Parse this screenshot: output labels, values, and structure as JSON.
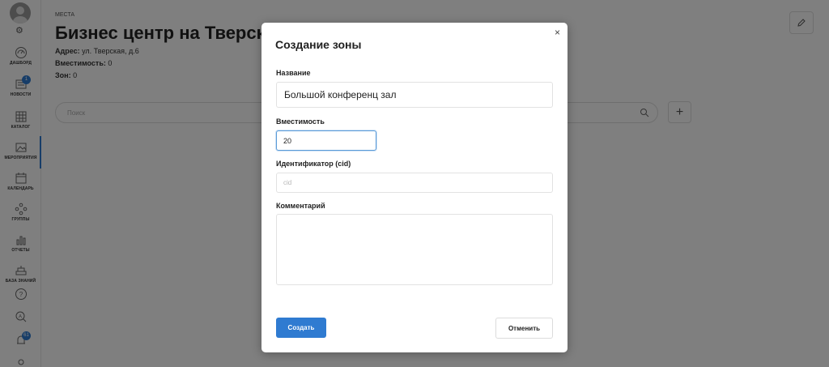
{
  "sidebar": {
    "items": [
      {
        "label": "ДАШБОРД",
        "icon": "dashboard-icon"
      },
      {
        "label": "НОВОСТИ",
        "icon": "news-icon",
        "badge": "1"
      },
      {
        "label": "КАТАЛОГ",
        "icon": "catalog-icon"
      },
      {
        "label": "МЕРОПРИЯТИЯ",
        "icon": "events-icon",
        "active": true
      },
      {
        "label": "КАЛЕНДАРЬ",
        "icon": "calendar-icon"
      },
      {
        "label": "ГРУППЫ",
        "icon": "groups-icon"
      },
      {
        "label": "ОТЧЕТЫ",
        "icon": "reports-icon"
      },
      {
        "label": "БАЗА ЗНАНИЙ",
        "icon": "knowledge-base-icon"
      }
    ],
    "bell_badge": "61",
    "colors": {
      "accent": "#2f7bd1"
    }
  },
  "page": {
    "breadcrumb": "МЕСТА",
    "title": "Бизнес центр на Тверской",
    "address_label": "Адрес:",
    "address_value": "ул. Тверская, д.6",
    "capacity_label": "Вместимость:",
    "capacity_value": "0",
    "zone_label": "Зон:",
    "zone_value": "0",
    "search_placeholder": "Поиск",
    "add_label": "+"
  },
  "modal": {
    "title": "Создание зоны",
    "close": "×",
    "name_label": "Название",
    "name_value": "Большой конференц зал",
    "capacity_label": "Вместимость",
    "capacity_value": "20",
    "cid_label": "Идентификатор (cid)",
    "cid_placeholder": "cid",
    "comment_label": "Комментарий",
    "comment_value": "",
    "create_label": "Создать",
    "cancel_label": "Отменить"
  }
}
